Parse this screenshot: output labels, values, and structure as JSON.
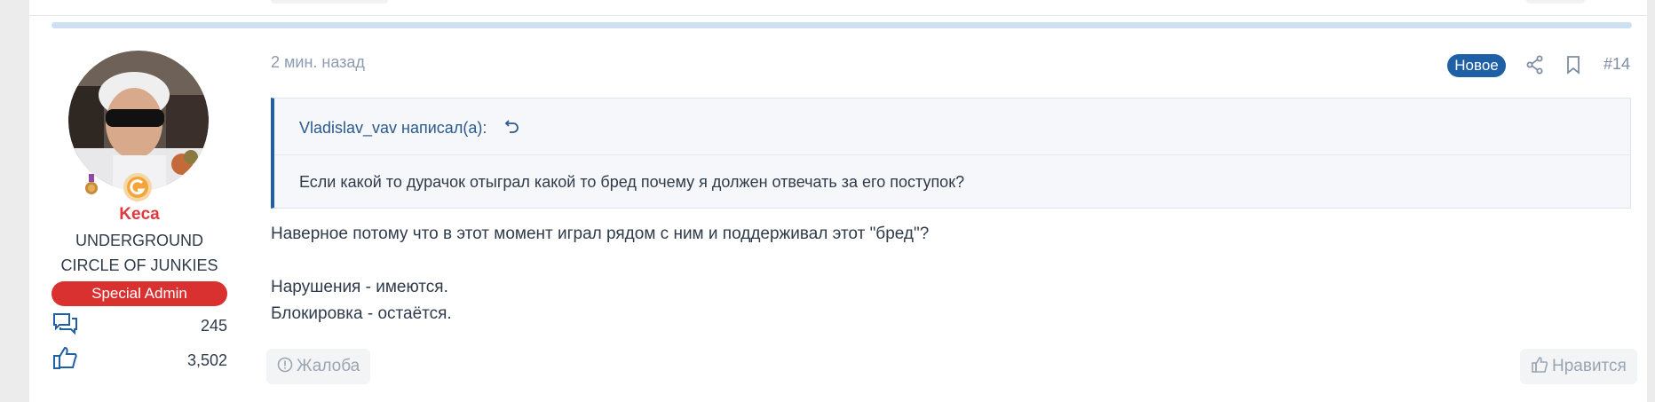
{
  "user": {
    "name": "Keca",
    "title": "UNDERGROUND CIRCLE OF JUNKIES",
    "banner": "Special Admin",
    "stats": [
      {
        "icon": "messages-icon",
        "value": "245"
      },
      {
        "icon": "likes-icon",
        "value": "3,502"
      }
    ]
  },
  "post": {
    "date": "2 мин. назад",
    "badge": "Новое",
    "number": "#14",
    "quote": {
      "author": "Vladislav_vav написал(а):",
      "text": "Если какой то дурачок отыграл какой то бред почему я должен отвечать за его поступок?"
    },
    "body": [
      "Наверное потому что в этот момент играл рядом с ним и поддерживал этот \"бред\"?",
      "Нарушения - имеются.",
      "Блокировка - остаётся."
    ],
    "actions": {
      "report": "Жалоба",
      "like": "Нравится"
    }
  },
  "colors": {
    "accent": "#1f5fa6",
    "username": "#e0383e",
    "banner": "#d93030",
    "separator": "#cfe0f2"
  }
}
